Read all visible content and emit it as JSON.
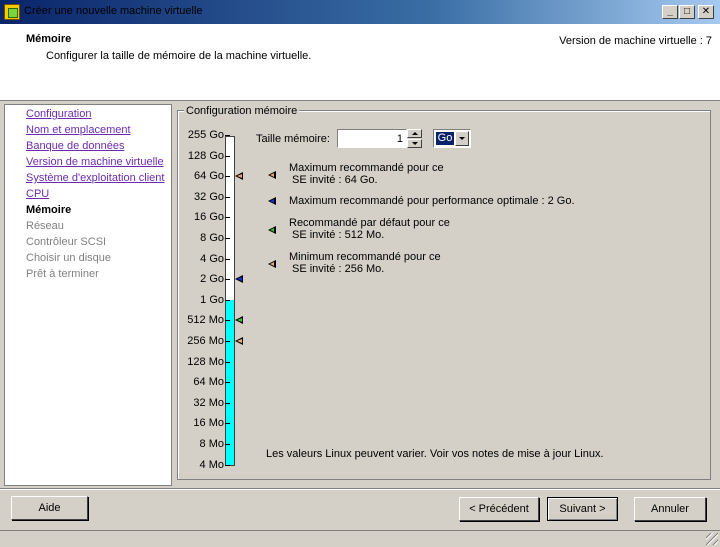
{
  "window": {
    "title": "Créer une nouvelle machine virtuelle",
    "min_label": "_",
    "max_label": "□",
    "close_label": "✕"
  },
  "header": {
    "title": "Mémoire",
    "subtitle": "Configurer la taille de mémoire de la machine virtuelle.",
    "vm_version": "Version de machine virtuelle : 7"
  },
  "nav": {
    "items": [
      {
        "label": "Configuration",
        "state": "link"
      },
      {
        "label": "Nom et emplacement",
        "state": "link"
      },
      {
        "label": "Banque de données",
        "state": "link"
      },
      {
        "label": "Version de machine virtuelle",
        "state": "link"
      },
      {
        "label": "Système d'exploitation client",
        "state": "link"
      },
      {
        "label": "CPU",
        "state": "link"
      },
      {
        "label": "Mémoire",
        "state": "current"
      },
      {
        "label": "Réseau",
        "state": "disabled"
      },
      {
        "label": "Contrôleur SCSI",
        "state": "disabled"
      },
      {
        "label": "Choisir un disque",
        "state": "disabled"
      },
      {
        "label": "Prêt à terminer",
        "state": "disabled"
      }
    ]
  },
  "memory": {
    "group_title": "Configuration mémoire",
    "size_label": "Taille mémoire:",
    "size_value": "1",
    "unit": "Go",
    "scale_ticks": [
      "255 Go",
      "128 Go",
      "64 Go",
      "32 Go",
      "16 Go",
      "8 Go",
      "4 Go",
      "2 Go",
      "1 Go",
      "512 Mo",
      "256 Mo",
      "128 Mo",
      "64 Mo",
      "32 Mo",
      "16 Mo",
      "8 Mo",
      "4 Mo"
    ],
    "current_level_tick": "1 Go",
    "markers": [
      {
        "tick": "64 Go",
        "color": "#e8a070",
        "name": "max-recommended-marker"
      },
      {
        "tick": "2 Go",
        "color": "#1030e0",
        "name": "optimal-marker"
      },
      {
        "tick": "512 Mo",
        "color": "#30c030",
        "name": "default-recommended-marker"
      },
      {
        "tick": "256 Mo",
        "color": "#e8b070",
        "name": "min-recommended-marker"
      }
    ],
    "legend": [
      {
        "lines": [
          "Maximum recommandé pour ce",
          "SE invité : 64 Go."
        ],
        "color": "#e8a070",
        "name": "legend-max"
      },
      {
        "lines": [
          "Maximum recommandé pour performance optimale : 2 Go."
        ],
        "color": "#1030e0",
        "name": "legend-optimal"
      },
      {
        "lines": [
          "Recommandé par défaut pour ce",
          "SE invité : 512 Mo."
        ],
        "color": "#30c030",
        "name": "legend-default"
      },
      {
        "lines": [
          "Minimum recommandé pour ce",
          "SE invité : 256 Mo."
        ],
        "color": "#e8b070",
        "name": "legend-min"
      }
    ],
    "note": "Les valeurs Linux peuvent varier. Voir vos notes de mise à jour Linux."
  },
  "buttons": {
    "help": "Aide",
    "previous": "< Précédent",
    "next": "Suivant >",
    "cancel": "Annuler"
  }
}
